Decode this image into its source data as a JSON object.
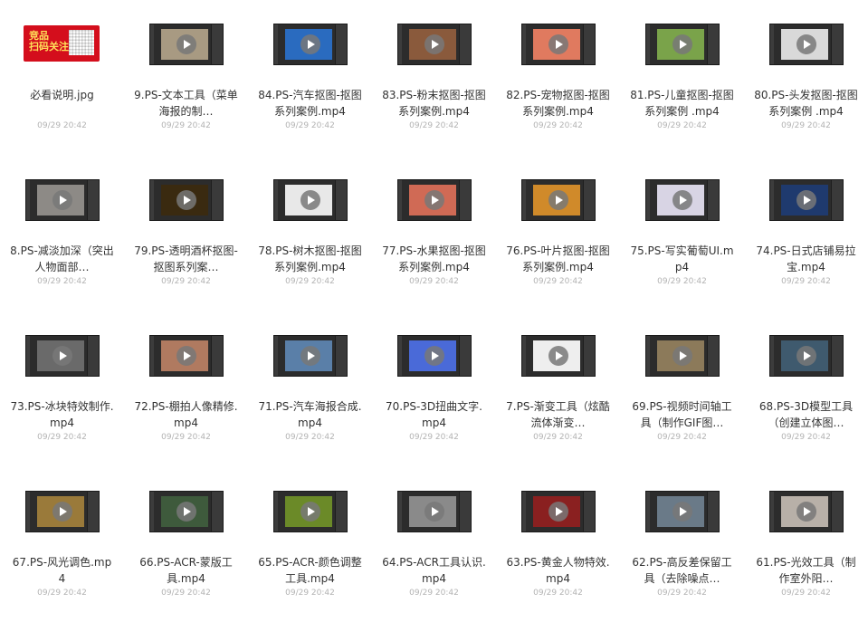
{
  "files": [
    {
      "name": "必看说明.jpg",
      "date": "09/29 20:42",
      "type": "image",
      "promo_text": "竞品\n扫码关注",
      "canvas": "#c9161f"
    },
    {
      "name": "9.PS-文本工具（菜单海报的制…",
      "date": "09/29 20:42",
      "type": "video",
      "canvas": "#a89a82"
    },
    {
      "name": "84.PS-汽车抠图-抠图系列案例.mp4",
      "date": "09/29 20:42",
      "type": "video",
      "canvas": "#2a6bbf"
    },
    {
      "name": "83.PS-粉末抠图-抠图系列案例.mp4",
      "date": "09/29 20:42",
      "type": "video",
      "canvas": "#8a5a3c"
    },
    {
      "name": "82.PS-宠物抠图-抠图系列案例.mp4",
      "date": "09/29 20:42",
      "type": "video",
      "canvas": "#e07a5f"
    },
    {
      "name": "81.PS-儿童抠图-抠图系列案例 .mp4",
      "date": "09/29 20:42",
      "type": "video",
      "canvas": "#7aa34a"
    },
    {
      "name": "80.PS-头发抠图-抠图系列案例 .mp4",
      "date": "09/29 20:42",
      "type": "video",
      "canvas": "#d9d9d9"
    },
    {
      "name": "8.PS-减淡加深（突出人物面部…",
      "date": "09/29 20:42",
      "type": "video",
      "canvas": "#8d8a86"
    },
    {
      "name": "79.PS-透明酒杯抠图-抠图系列案…",
      "date": "09/29 20:42",
      "type": "video",
      "canvas": "#3a2a10"
    },
    {
      "name": "78.PS-树木抠图-抠图系列案例.mp4",
      "date": "09/29 20:42",
      "type": "video",
      "canvas": "#e8e8e8"
    },
    {
      "name": "77.PS-水果抠图-抠图系列案例.mp4",
      "date": "09/29 20:42",
      "type": "video",
      "canvas": "#d06a55"
    },
    {
      "name": "76.PS-叶片抠图-抠图系列案例.mp4",
      "date": "09/29 20:42",
      "type": "video",
      "canvas": "#d08a2a"
    },
    {
      "name": "75.PS-写实葡萄UI.mp4",
      "date": "09/29 20:42",
      "type": "video",
      "canvas": "#d8d4e4"
    },
    {
      "name": "74.PS-日式店铺易拉宝.mp4",
      "date": "09/29 20:42",
      "type": "video",
      "canvas": "#1f3a6e"
    },
    {
      "name": "73.PS-冰块特效制作.mp4",
      "date": "09/29 20:42",
      "type": "video",
      "canvas": "#6a6a6a"
    },
    {
      "name": "72.PS-棚拍人像精修.mp4",
      "date": "09/29 20:42",
      "type": "video",
      "canvas": "#b07a60"
    },
    {
      "name": "71.PS-汽车海报合成.mp4",
      "date": "09/29 20:42",
      "type": "video",
      "canvas": "#5a7fa8"
    },
    {
      "name": "70.PS-3D扭曲文字.mp4",
      "date": "09/29 20:42",
      "type": "video",
      "canvas": "#4a6ad8"
    },
    {
      "name": "7.PS-渐变工具（炫酷流体渐变…",
      "date": "09/29 20:42",
      "type": "video",
      "canvas": "#eeeeee"
    },
    {
      "name": "69.PS-视频时间轴工具（制作GIF图…",
      "date": "09/29 20:42",
      "type": "video",
      "canvas": "#8c7a5a"
    },
    {
      "name": "68.PS-3D模型工具（创建立体图…",
      "date": "09/29 20:42",
      "type": "video",
      "canvas": "#3f5a6e"
    },
    {
      "name": "67.PS-风光调色.mp4",
      "date": "09/29 20:42",
      "type": "video",
      "canvas": "#9a7a3a"
    },
    {
      "name": "66.PS-ACR-蒙版工具.mp4",
      "date": "09/29 20:42",
      "type": "video",
      "canvas": "#3e5a3c"
    },
    {
      "name": "65.PS-ACR-颜色调整工具.mp4",
      "date": "09/29 20:42",
      "type": "video",
      "canvas": "#6b8a28"
    },
    {
      "name": "64.PS-ACR工具认识.mp4",
      "date": "09/29 20:42",
      "type": "video",
      "canvas": "#8a8a8a"
    },
    {
      "name": "63.PS-黄金人物特效.mp4",
      "date": "09/29 20:42",
      "type": "video",
      "canvas": "#8a2020"
    },
    {
      "name": "62.PS-高反差保留工具（去除噪点…",
      "date": "09/29 20:42",
      "type": "video",
      "canvas": "#6a7a88"
    },
    {
      "name": "61.PS-光效工具（制作室外阳…",
      "date": "09/29 20:42",
      "type": "video",
      "canvas": "#b8b0a8"
    }
  ]
}
